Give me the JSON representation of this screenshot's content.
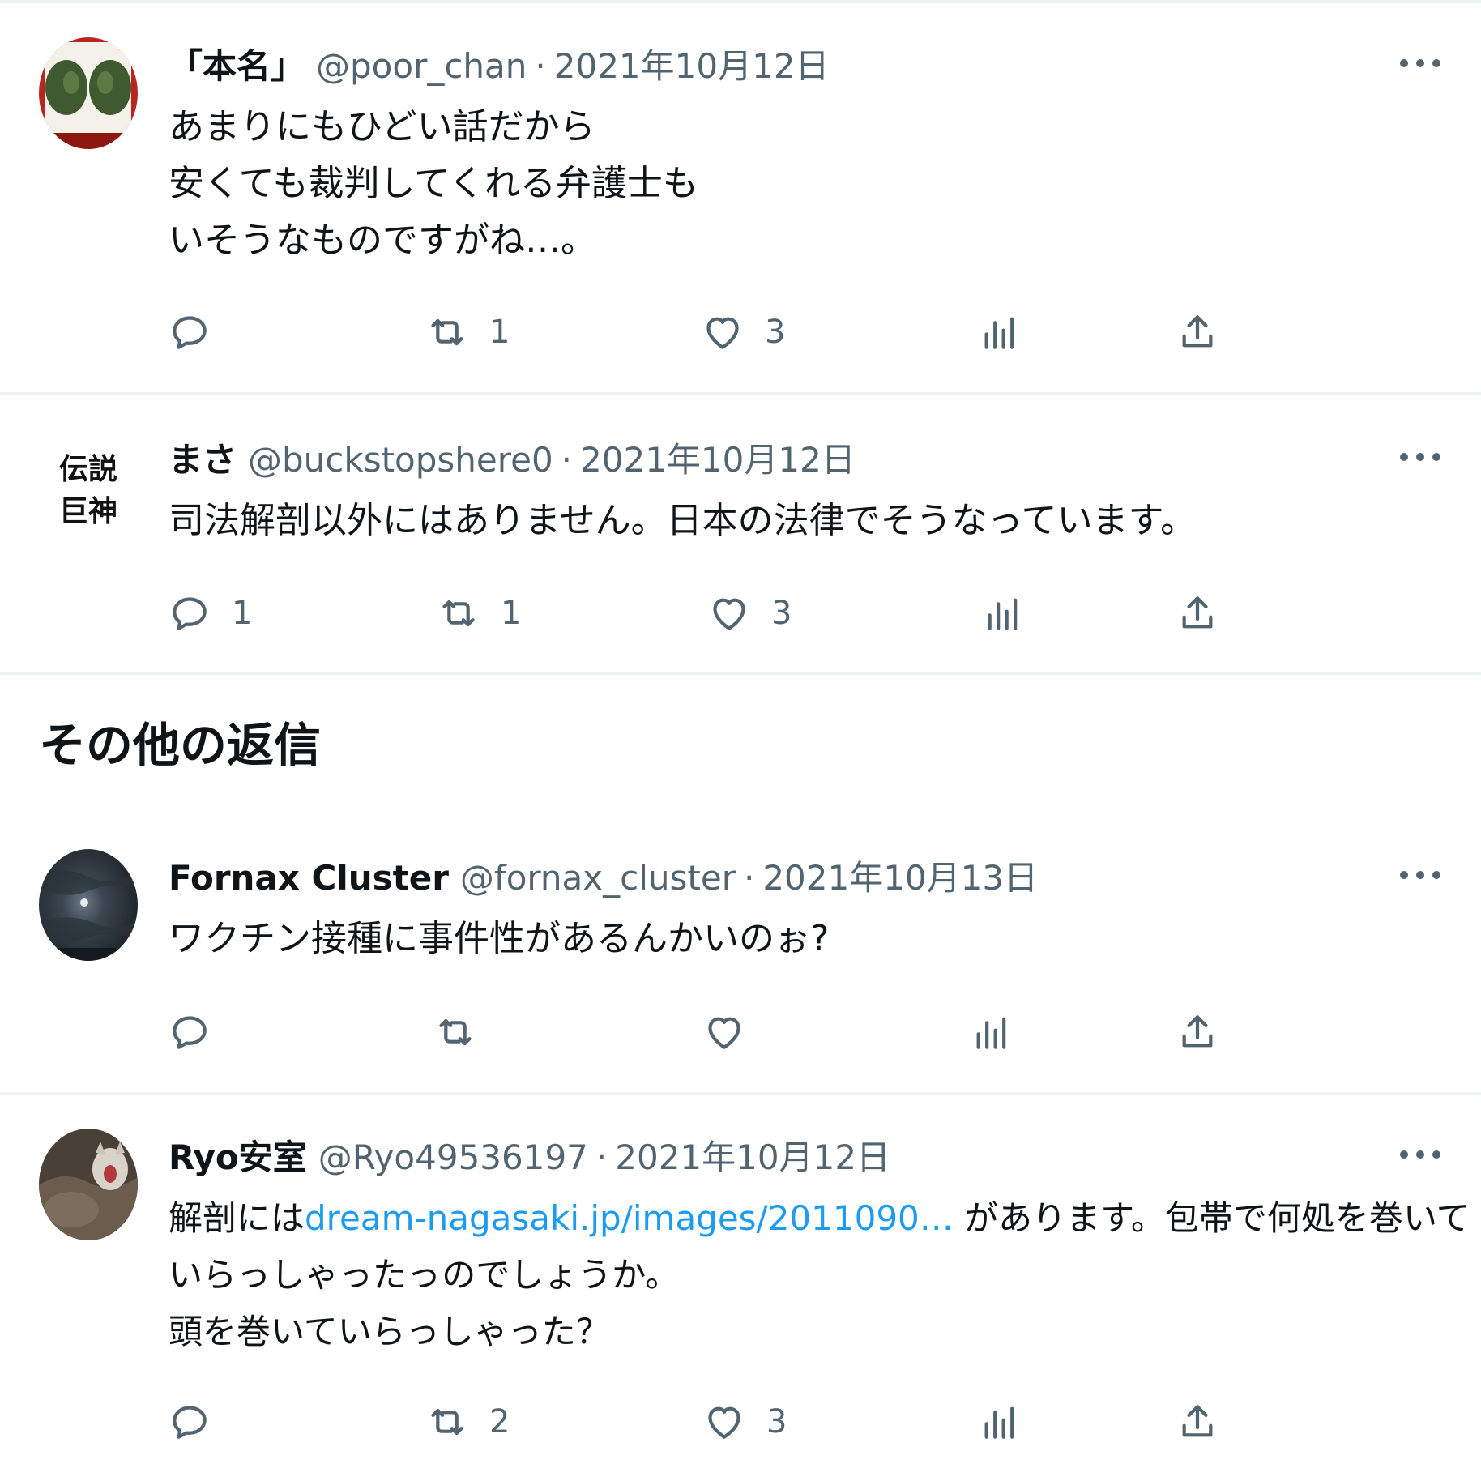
{
  "tweets": [
    {
      "name": "「本名」",
      "handle": "@poor_chan",
      "date": "2021年10月12日",
      "lines": [
        "あまりにもひどい話だから",
        "安くても裁判してくれる弁護士も",
        "いそうなものですがね…。"
      ],
      "replies": "",
      "retweets": "1",
      "likes": "3"
    },
    {
      "name": "まさ",
      "handle": "@buckstopshere0",
      "date": "2021年10月12日",
      "avatar_text": [
        "伝説",
        "巨神"
      ],
      "lines": [
        "司法解剖以外にはありません。日本の法律でそうなっています。"
      ],
      "replies": "1",
      "retweets": "1",
      "likes": "3"
    },
    {
      "name": "Fornax Cluster",
      "handle": "@fornax_cluster",
      "date": "2021年10月13日",
      "lines": [
        "ワクチン接種に事件性があるんかいのぉ?"
      ],
      "replies": "",
      "retweets": "",
      "likes": ""
    },
    {
      "name": "Ryo安室",
      "handle": "@Ryo49536197",
      "date": "2021年10月12日",
      "line1_prefix": "解剖には",
      "line1_link": "dream-nagasaki.jp/images/2011090…",
      "line1_suffix": " があります。包帯で何処を巻いて",
      "lines": [
        "いらっしゃったっのでしょうか。",
        "頭を巻いていらっしゃった？"
      ],
      "replies": "",
      "retweets": "2",
      "likes": "3"
    }
  ],
  "section_heading": "その他の返信",
  "separator": "·",
  "colors": {
    "text": "#0f1419",
    "secondary": "#536471",
    "link": "#1d9bf0",
    "divider": "#eff3f4"
  },
  "icons": [
    "reply-icon",
    "retweet-icon",
    "like-icon",
    "views-icon",
    "share-icon",
    "more-icon"
  ]
}
